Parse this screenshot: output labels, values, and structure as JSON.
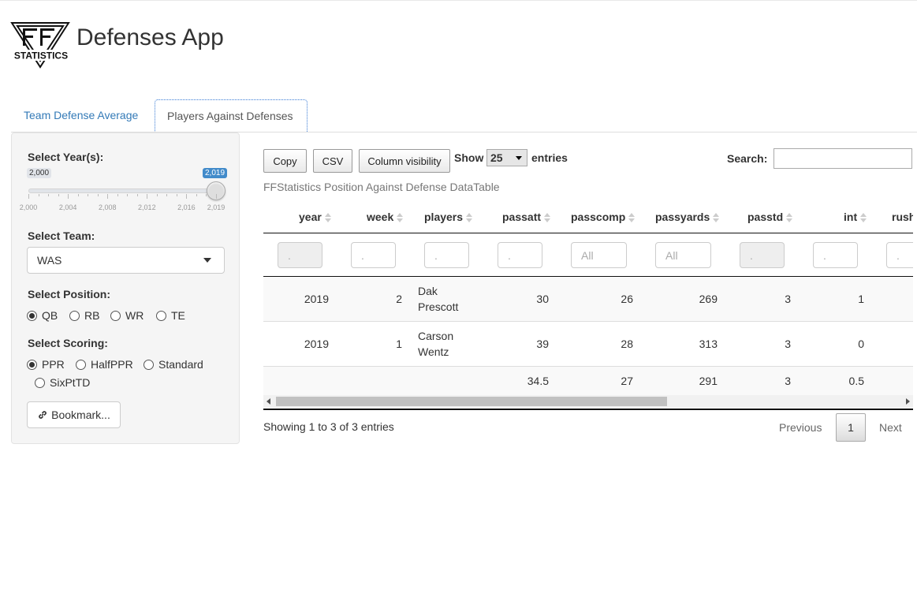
{
  "header": {
    "logo_text": "STATISTICS",
    "title": "Defenses App"
  },
  "tabs": [
    {
      "label": "Team Defense Average"
    },
    {
      "label": "Players Against Defenses"
    }
  ],
  "sidebar": {
    "year": {
      "label": "Select Year(s):",
      "min_bubble": "2,000",
      "max_bubble": "2,019",
      "range_min": 2000,
      "range_max": 2019,
      "selected": [
        2000,
        2019
      ],
      "tick_labels": [
        "2,000",
        "2,004",
        "2,008",
        "2,012",
        "2,016",
        "2,019"
      ]
    },
    "team": {
      "label": "Select Team:",
      "value": "WAS"
    },
    "position": {
      "label": "Select Position:",
      "options": [
        "QB",
        "RB",
        "WR",
        "TE"
      ],
      "selected": "QB"
    },
    "scoring": {
      "label": "Select Scoring:",
      "options": [
        "PPR",
        "HalfPPR",
        "Standard",
        "SixPtTD"
      ],
      "selected": "PPR"
    },
    "bookmark_label": "Bookmark..."
  },
  "table": {
    "buttons": {
      "copy": "Copy",
      "csv": "CSV",
      "colvis": "Column visibility"
    },
    "length": {
      "show_label": "Show",
      "value": "25",
      "entries_label": "entries"
    },
    "search_label": "Search:",
    "caption": "FFStatistics Position Against Defense DataTable",
    "columns": [
      "year",
      "week",
      "players",
      "passatt",
      "passcomp",
      "passyards",
      "passtd",
      "int",
      "rush"
    ],
    "filters": [
      ".",
      ".",
      ".",
      ".",
      "All",
      "All",
      ".",
      ".",
      "."
    ],
    "rows": [
      {
        "year": "2019",
        "week": "2",
        "players_1": "Dak",
        "players_2": "Prescott",
        "passatt": "30",
        "passcomp": "26",
        "passyards": "269",
        "passtd": "3",
        "int": "1"
      },
      {
        "year": "2019",
        "week": "1",
        "players_1": "Carson",
        "players_2": "Wentz",
        "passatt": "39",
        "passcomp": "28",
        "passyards": "313",
        "passtd": "3",
        "int": "0"
      }
    ],
    "footer": {
      "passatt": "34.5",
      "passcomp": "27",
      "passyards": "291",
      "passtd": "3",
      "int": "0.5"
    },
    "info": "Showing 1 to 3 of 3 entries",
    "pagination": {
      "previous": "Previous",
      "current": "1",
      "next": "Next"
    }
  },
  "colors": {
    "accent": "#337ab7",
    "slider_active": "#428bca",
    "sidebar_bg": "#f5f5f5"
  }
}
